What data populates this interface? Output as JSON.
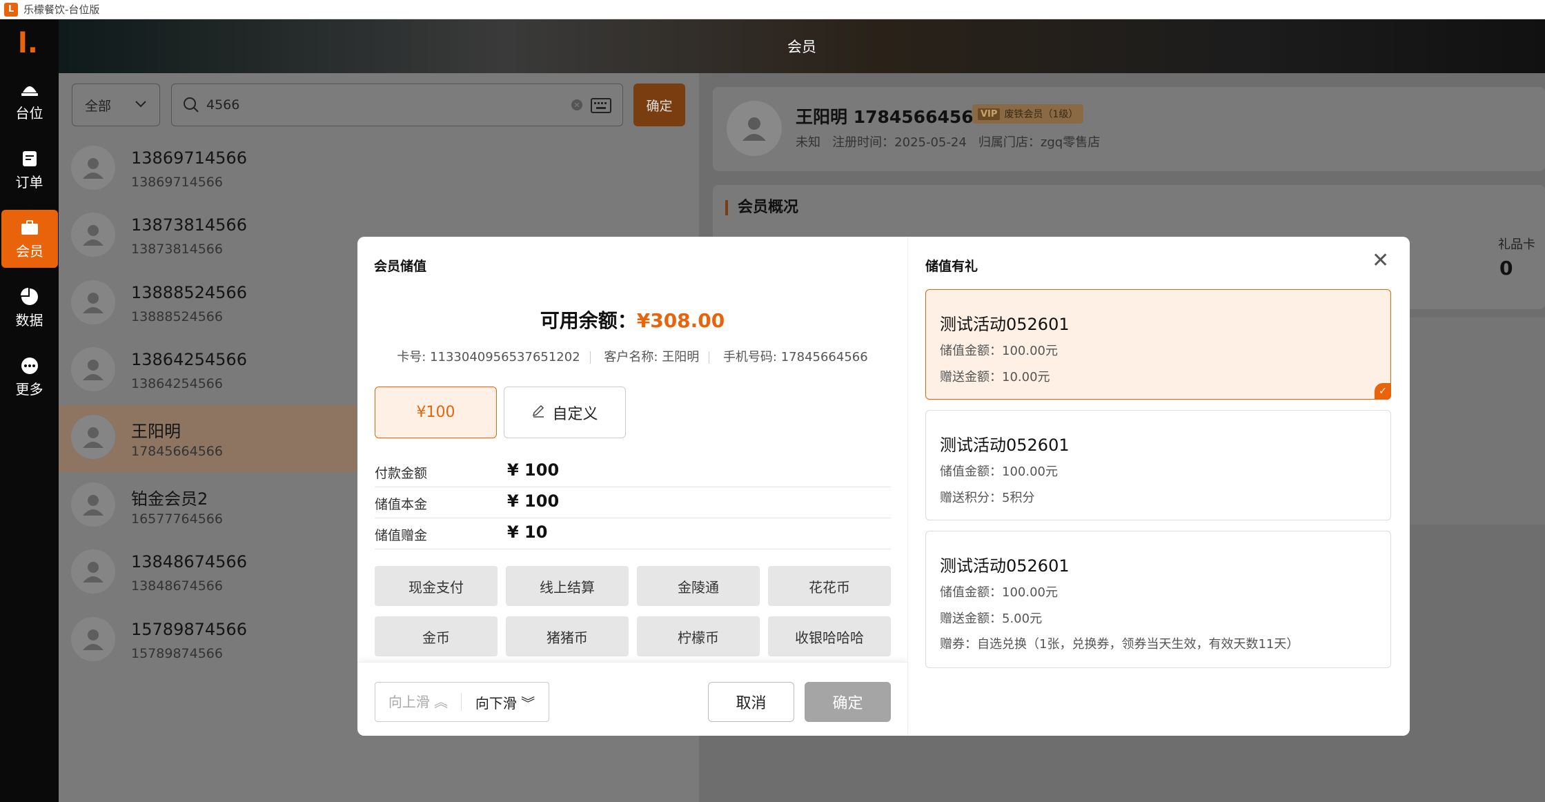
{
  "window": {
    "title": "乐檬餐饮-台位版"
  },
  "nav": [
    {
      "label": "台位",
      "icon": "table-icon"
    },
    {
      "label": "订单",
      "icon": "order-icon"
    },
    {
      "label": "会员",
      "icon": "member-icon"
    },
    {
      "label": "数据",
      "icon": "pie-chart-icon"
    },
    {
      "label": "更多",
      "icon": "more-icon"
    }
  ],
  "header": {
    "title": "会员"
  },
  "search": {
    "filter": "全部",
    "value": "4566",
    "confirm": "确定"
  },
  "members": [
    {
      "name": "13869714566",
      "phone": "13869714566"
    },
    {
      "name": "13873814566",
      "phone": "13873814566"
    },
    {
      "name": "13888524566",
      "phone": "13888524566"
    },
    {
      "name": "13864254566",
      "phone": "13864254566"
    },
    {
      "name": "王阳明",
      "phone": "17845664566"
    },
    {
      "name": "铂金会员2",
      "phone": "16577764566"
    },
    {
      "name": "13848674566",
      "phone": "13848674566"
    },
    {
      "name": "15789874566",
      "phone": "15789874566"
    }
  ],
  "profile": {
    "name": "王阳明 17845664566",
    "vip_tag": "VIP",
    "level": "废铁会员（1级）",
    "meta": "未知   注册时间：2025-05-24   归属门店：zgq零售店"
  },
  "overview": {
    "title": "会员概况",
    "gift_card_label": "礼品卡",
    "gift_card_value": "0"
  },
  "modal": {
    "title": "会员储值",
    "balance_label": "可用余额：",
    "balance_value": "¥308.00",
    "card_no": "卡号: 1133040956537651202",
    "customer": "客户名称: 王阳明",
    "mobile": "手机号码: 17845664566",
    "options": [
      "¥100",
      "自定义"
    ],
    "rows": [
      {
        "label": "付款金额",
        "value": "¥ 100"
      },
      {
        "label": "储值本金",
        "value": "¥ 100"
      },
      {
        "label": "储值赠金",
        "value": "¥ 10"
      }
    ],
    "payments": [
      "现金支付",
      "线上结算",
      "金陵通",
      "花花币",
      "金币",
      "猪猪币",
      "柠檬币",
      "收银哈哈哈"
    ],
    "scroll_up": "向上滑",
    "scroll_down": "向下滑",
    "cancel": "取消",
    "confirm": "确定"
  },
  "gifts": {
    "title": "储值有礼",
    "activities": [
      {
        "name": "测试活动052601",
        "lines": [
          "储值金额：100.00元",
          "赠送金额：10.00元"
        ]
      },
      {
        "name": "测试活动052601",
        "lines": [
          "储值金额：100.00元",
          "赠送积分：5积分"
        ]
      },
      {
        "name": "测试活动052601",
        "lines": [
          "储值金额：100.00元",
          "赠送金额：5.00元",
          "赠券：自选兑换（1张，兑换券，领券当天生效，有效天数11天）"
        ]
      }
    ]
  },
  "colors": {
    "accent": "#e8630a",
    "accent_bg": "#fef0e5"
  }
}
